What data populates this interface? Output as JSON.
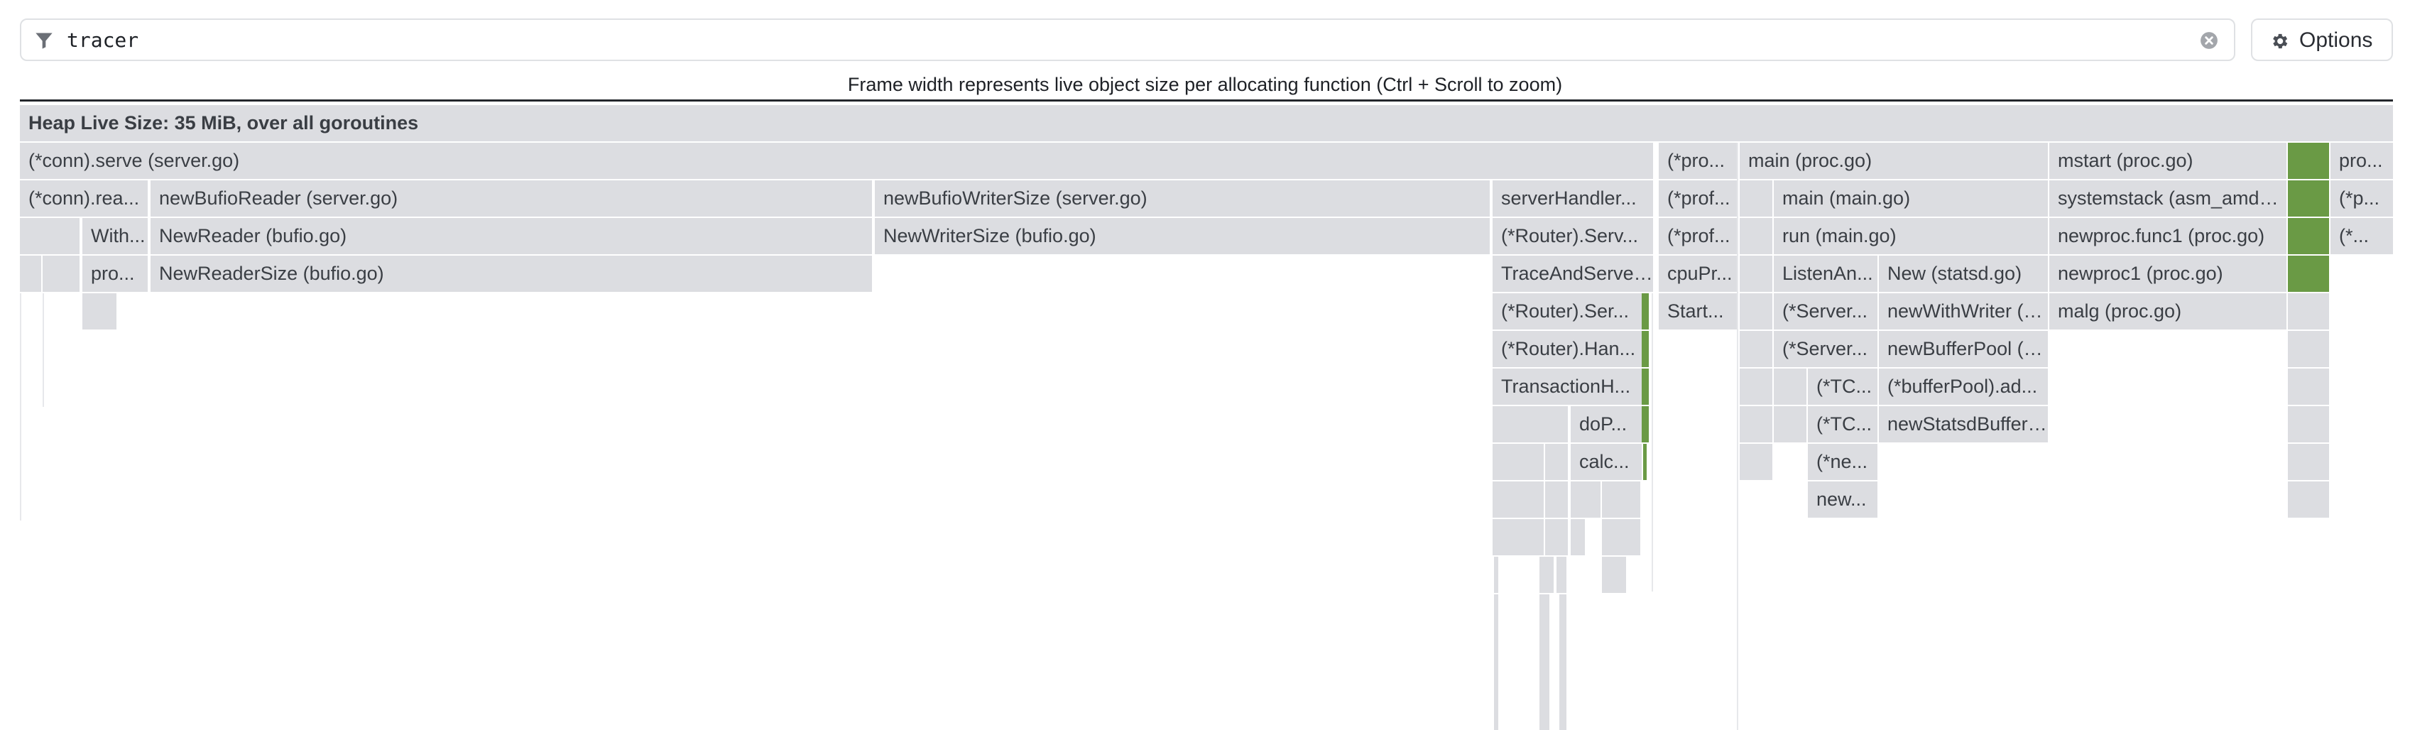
{
  "search": {
    "value": "tracer",
    "placeholder": ""
  },
  "options": {
    "label": "Options"
  },
  "caption": "Frame width represents live object size per allocating function (Ctrl + Scroll to zoom)",
  "icons": {
    "filter": "filter-icon",
    "clear": "clear-icon",
    "gear": "gear-icon"
  },
  "colors": {
    "frame": "#dcdde1",
    "highlight": "#6a9a45",
    "text": "#3a3e44"
  },
  "flamegraph": {
    "root": "Heap Live Size: 35 MiB, over all goroutines",
    "labels": {
      "conn_serve": "(*conn).serve (server.go)",
      "pro_1": "(*pro...",
      "main_proc": "main (proc.go)",
      "mstart": "mstart (proc.go)",
      "pro_2": "pro...",
      "conn_rea": "(*conn).rea...",
      "newBufioReader": "newBufioReader (server.go)",
      "newBufioWriterSize": "newBufioWriterSize (server.go)",
      "serverHandler": "serverHandler...",
      "prof_1": "(*prof...",
      "main_main": "main (main.go)",
      "systemstack": "systemstack (asm_amd64...",
      "p_1": "(*p...",
      "with": "With...",
      "NewReader": "NewReader (bufio.go)",
      "NewWriterSize": "NewWriterSize (bufio.go)",
      "router_serv": "(*Router).Serv...",
      "prof_2": "(*prof...",
      "run_main": "run (main.go)",
      "newproc_func1": "newproc.func1 (proc.go)",
      "star_1": "(*...",
      "pro_3": "pro...",
      "NewReaderSize": "NewReaderSize (bufio.go)",
      "TraceAndServe": "TraceAndServe ...",
      "cpuPr": "cpuPr...",
      "ListenAn": "ListenAn...",
      "New_statsd": "New (statsd.go)",
      "newproc1": "newproc1 (proc.go)",
      "router_ser": "(*Router).Ser...",
      "Start": "Start...",
      "server_1": "(*Server...",
      "newWithWriter": "newWithWriter (s...",
      "malg": "malg (proc.go)",
      "router_han": "(*Router).Han...",
      "server_2": "(*Server...",
      "newBufferPool": "newBufferPool (b...",
      "TransactionH": "TransactionH...",
      "tc_1": "(*TC...",
      "bufferPool_ad": "(*bufferPool).ad...",
      "doP": "doP...",
      "tc_2": "(*TC...",
      "newStatsdBuffer": "newStatsdBuffer ...",
      "calc": "calc...",
      "ne": "(*ne...",
      "new": "new..."
    }
  }
}
